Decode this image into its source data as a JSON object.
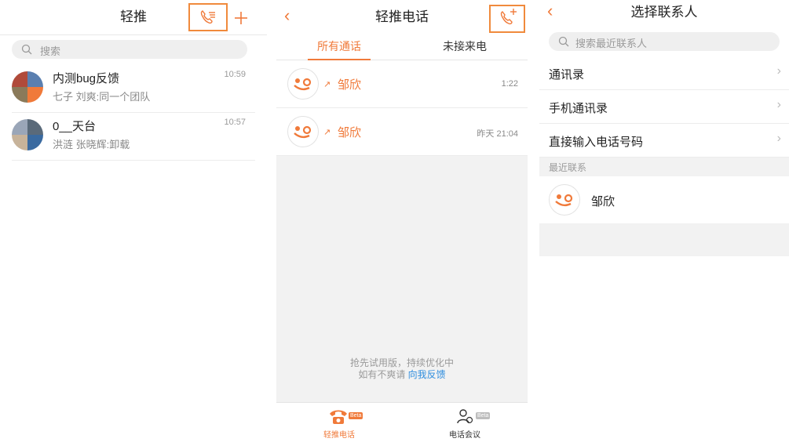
{
  "screen1": {
    "title": "轻推",
    "search_placeholder": "搜索",
    "chats": [
      {
        "name": "内测bug反馈",
        "subtitle": "七子 刘爽:同一个团队",
        "time": "10:59"
      },
      {
        "name": "0__天台",
        "subtitle": "洪涟 张晓辉:卸载",
        "time": "10:57"
      }
    ],
    "icons": {
      "phone": "phone-list-icon",
      "plus": "plus-icon",
      "search": "search-icon"
    }
  },
  "screen2": {
    "title": "轻推电话",
    "tabs": [
      {
        "label": "所有通话",
        "active": true
      },
      {
        "label": "未接来电",
        "active": false
      }
    ],
    "calls": [
      {
        "name": "邹欣",
        "time": "1:22"
      },
      {
        "name": "邹欣",
        "time": "昨天 21:04"
      }
    ],
    "beta_note_line1": "抢先试用版，持续优化中",
    "beta_note_line2_prefix": "如有不爽请 ",
    "beta_note_link": "向我反馈",
    "nav": [
      {
        "label": "轻推电话",
        "badge": "Beta",
        "active": true
      },
      {
        "label": "电话会议",
        "badge": "Beta",
        "active": false
      }
    ]
  },
  "screen3": {
    "title": "选择联系人",
    "search_placeholder": "搜索最近联系人",
    "menu": [
      "通讯录",
      "手机通讯录",
      "直接输入电话号码"
    ],
    "section": "最近联系",
    "recent": [
      {
        "name": "邹欣"
      }
    ]
  },
  "colors": {
    "accent": "#f07a3a",
    "highlight_box": "#f08a3c",
    "link": "#2f8dde"
  }
}
